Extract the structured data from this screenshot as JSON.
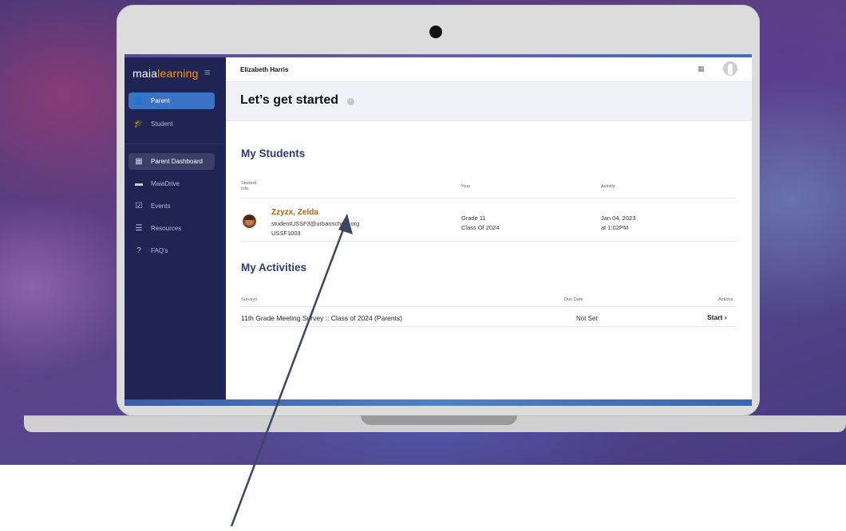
{
  "app": {
    "logo_main": "maia",
    "logo_accent": "learning",
    "menu_icon": "hamburger-icon"
  },
  "sidebar": {
    "roles": [
      {
        "label": "Parent",
        "icon": "person-icon",
        "active": true
      },
      {
        "label": "Student",
        "icon": "graduation-cap-icon",
        "active": false
      }
    ],
    "items": [
      {
        "label": "Parent Dashboard",
        "icon": "grid-icon",
        "active": true
      },
      {
        "label": "MaiaDrive",
        "icon": "drive-icon",
        "active": false
      },
      {
        "label": "Events",
        "icon": "calendar-check-icon",
        "active": false
      },
      {
        "label": "Resources",
        "icon": "list-icon",
        "active": false
      },
      {
        "label": "FAQ's",
        "icon": "question-icon",
        "active": false
      }
    ]
  },
  "header": {
    "user_name": "Elizabeth Harris",
    "calendar_icon": "calendar-icon",
    "avatar_icon": "user-avatar-icon"
  },
  "hero": {
    "title": "Let’s get started",
    "info_icon": "info-icon"
  },
  "students": {
    "title": "My Students",
    "columns": {
      "student_info_line1": "Student",
      "student_info_line2": "Info",
      "year": "Year",
      "activity": "Activity"
    },
    "rows": [
      {
        "name": "Zzyzx, Zelda",
        "email": "studentUSSF3@urbanschool.org",
        "id": "USSF1003",
        "grade": "Grade 11",
        "class_of": "Class Of 2024",
        "activity_date": "Jan 04, 2023",
        "activity_time": "at 1:02PM"
      }
    ]
  },
  "activities": {
    "title": "My Activities",
    "columns": {
      "surveys": "Surveys",
      "due_date": "Due Date",
      "actions": "Actions"
    },
    "rows": [
      {
        "title": "11th Grade Meeting Survey :: Class of 2024 (Parents)",
        "due": "Not Set",
        "action": "Start"
      }
    ]
  },
  "colors": {
    "sidebar_bg": "#1f2452",
    "active_blue": "#3b73c4",
    "heading_navy": "#2d3a7a",
    "student_name": "#b4621f",
    "logo_accent": "#f59a23"
  }
}
